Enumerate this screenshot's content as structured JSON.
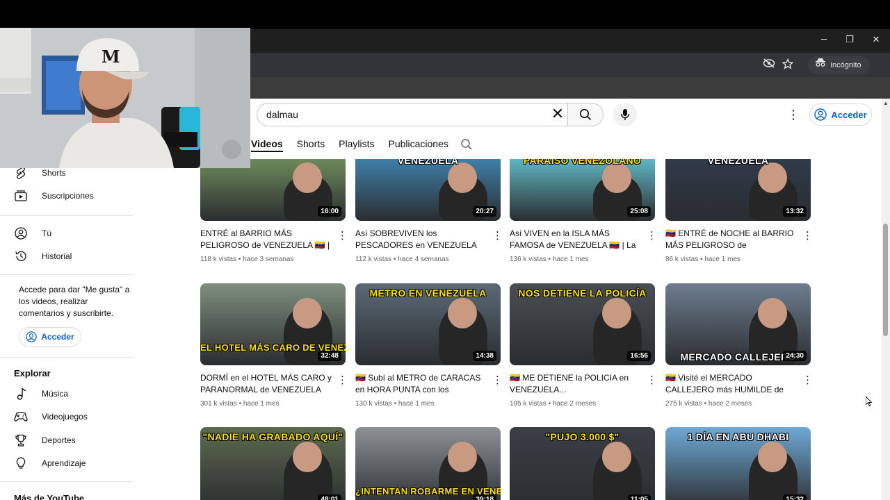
{
  "browser": {
    "mode_label": "Incógnito",
    "window_controls": [
      "─",
      "❐",
      "✕"
    ],
    "icons": [
      "eye-off-icon",
      "star-icon",
      "incognito-icon"
    ]
  },
  "header": {
    "search_value": "dalmau",
    "sign_in": "Acceder",
    "icons": [
      "clear-icon",
      "search-icon",
      "mic-icon",
      "more-icon",
      "account-icon"
    ]
  },
  "tabs": [
    "Videos",
    "Shorts",
    "Playlists",
    "Publicaciones"
  ],
  "sidebar": {
    "top_items": [
      {
        "label": "Shorts",
        "icon": "shorts-icon"
      },
      {
        "label": "Suscripciones",
        "icon": "subscriptions-icon"
      },
      {
        "label": "Tú",
        "icon": "you-icon"
      },
      {
        "label": "Historial",
        "icon": "history-icon"
      }
    ],
    "signin_note": "Accede para dar \"Me gusta\" a los videos, realizar comentarios y suscribirte.",
    "signin_button": "Acceder",
    "explore_heading": "Explorar",
    "explore_items": [
      {
        "label": "Música",
        "icon": "music-icon"
      },
      {
        "label": "Videojuegos",
        "icon": "gaming-icon"
      },
      {
        "label": "Deportes",
        "icon": "trophy-icon"
      },
      {
        "label": "Aprendizaje",
        "icon": "lightbulb-icon"
      }
    ],
    "more_heading": "Más de YouTube"
  },
  "videos": [
    {
      "title": "ENTRÉ al BARRIO MÁS PELIGROSO de VENEZUELA 🇻🇪 | PETARE SIN...",
      "views": "118 k vistas",
      "age": "hace 3 semanas",
      "duration": "16:00",
      "overlay": "",
      "bg": "#6d8a5a"
    },
    {
      "title": "Así SOBREVIVEN los PESCADORES en VENEZUELA 🇻🇪 🎣",
      "views": "112 k vistas",
      "age": "hace 4 semanas",
      "duration": "20:27",
      "overlay": "VENEZUELA",
      "bg": "#3f7fa8"
    },
    {
      "title": "Así VIVEN en la ISLA MÁS FAMOSA de VENEZUELA 🇻🇪 | La Realidad de...",
      "views": "136 k vistas",
      "age": "hace 1 mes",
      "duration": "25:08",
      "overlay": "PARAISO VENEZOLANO",
      "bg": "#5fb6c2"
    },
    {
      "title": "🇻🇪 ENTRÉ de NOCHE al BARRIO MÁS PELIGROSO de VENEZUELA |...",
      "views": "86 k vistas",
      "age": "hace 1 mes",
      "duration": "13:32",
      "overlay": "VENEZUELA",
      "bg": "#2f3a4a"
    },
    {
      "title": "DORMÍ en el HOTEL MÁS CARO y PARANORMAL de VENEZUELA 🇻🇪 |...",
      "views": "301 k vistas",
      "age": "hace 1 mes",
      "duration": "32:48",
      "overlay": "EL HOTEL MÁS CARO DE VENEZUELA",
      "bg": "#7f8f7e"
    },
    {
      "title": "🇻🇪 Subí al METRO de CARACAS en HORA PUNTA con los FAMOSOS...",
      "views": "130 k vistas",
      "age": "hace 1 mes",
      "duration": "14:38",
      "overlay": "METRO EN VENEZUELA",
      "bg": "#5b6a77"
    },
    {
      "title": "🇻🇪 ME DETIENE la POLICIA en VENEZUELA...",
      "views": "195 k vistas",
      "age": "hace 2 meses",
      "duration": "16:56",
      "overlay": "NOS DETIENE LA POLICÍA",
      "bg": "#4a4d52"
    },
    {
      "title": "🇻🇪 Visité el MERCADO CALLEJERO más HUMILDE de CARACAS | La...",
      "views": "275 k vistas",
      "age": "hace 2 meses",
      "duration": "24:30",
      "overlay": "MERCADO CALLEJERO",
      "bg": "#6e7d90"
    },
    {
      "title": "",
      "views": "",
      "age": "",
      "duration": "48:01",
      "overlay": "\"NADIE HA GRABADO AQUÍ\"",
      "bg": "#5d6b4f"
    },
    {
      "title": "",
      "views": "",
      "age": "",
      "duration": "39:18",
      "overlay": "¿INTENTAN ROBARME EN VENEZUELA",
      "bg": "#8d9196"
    },
    {
      "title": "",
      "views": "",
      "age": "",
      "duration": "11:05",
      "overlay": "\"PUJO 3.000 $\"",
      "bg": "#3b3e44"
    },
    {
      "title": "",
      "views": "",
      "age": "",
      "duration": "15:32",
      "overlay": "1 DÍA EN ABU DHABI",
      "bg": "#6fa9d6"
    }
  ]
}
